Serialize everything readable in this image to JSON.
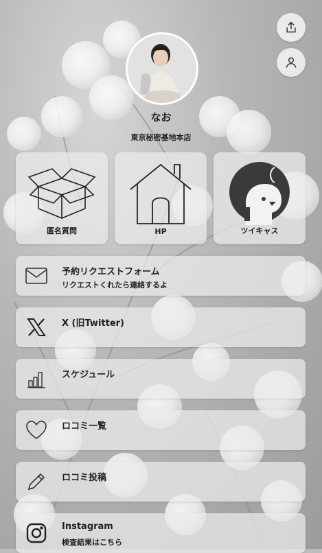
{
  "profile": {
    "name": "なお",
    "shop": "東京秘密基地本店"
  },
  "top_buttons": {
    "share_icon": "share-icon",
    "user_icon": "user-icon"
  },
  "tiles": [
    {
      "label": "匿名質問",
      "icon": "box-icon"
    },
    {
      "label": "HP",
      "icon": "house-icon"
    },
    {
      "label": "ツイキャス",
      "icon": "twitcasting-icon"
    }
  ],
  "rows": [
    {
      "title": "予約リクエストフォーム",
      "subtitle": "リクエストくれたら連絡するよ",
      "icon": "mail-icon"
    },
    {
      "title": "X (旧Twitter)",
      "subtitle": "",
      "icon": "x-logo-icon"
    },
    {
      "title": "スケジュール",
      "subtitle": "",
      "icon": "bar-chart-icon"
    },
    {
      "title": "ロコミ一覧",
      "subtitle": "",
      "icon": "heart-icon"
    },
    {
      "title": "ロコミ投稿",
      "subtitle": "",
      "icon": "pencil-icon"
    },
    {
      "title": "Instagram",
      "subtitle": "検査結果はこちら",
      "icon": "instagram-icon"
    }
  ]
}
